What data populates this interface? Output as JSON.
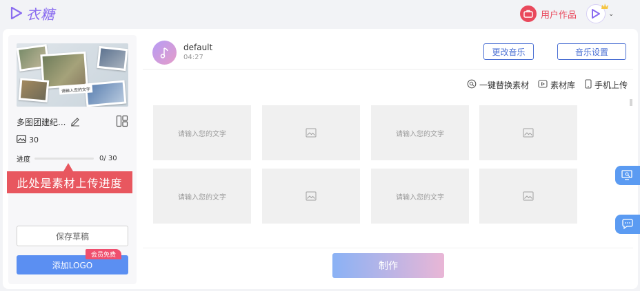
{
  "header": {
    "app_name": "衣糖",
    "user_works_label": "用户作品"
  },
  "project": {
    "name": "多图团建纪...",
    "thumb_caption": "请输入您的文字",
    "photo_count": "30",
    "progress_label": "进度",
    "progress_value": "0/ 30",
    "progress_fraction": 0
  },
  "annotation": {
    "callout_text": "此处是素材上传进度"
  },
  "left_actions": {
    "save_draft_label": "保存草稿",
    "add_logo_label": "添加LOGO",
    "vip_badge": "会员免费"
  },
  "music": {
    "name": "default",
    "duration": "04:27",
    "change_label": "更改音乐",
    "settings_label": "音乐设置"
  },
  "tools": {
    "replace_label": "一键替换素材",
    "library_label": "素材库",
    "phone_upload_label": "手机上传"
  },
  "grid": {
    "text_placeholder": "请输入您的文字"
  },
  "bottom": {
    "make_label": "制作"
  },
  "colors": {
    "accent_blue": "#4a6fd3",
    "callout_red": "#e8575f",
    "brand_purple": "#8a6cf0"
  }
}
